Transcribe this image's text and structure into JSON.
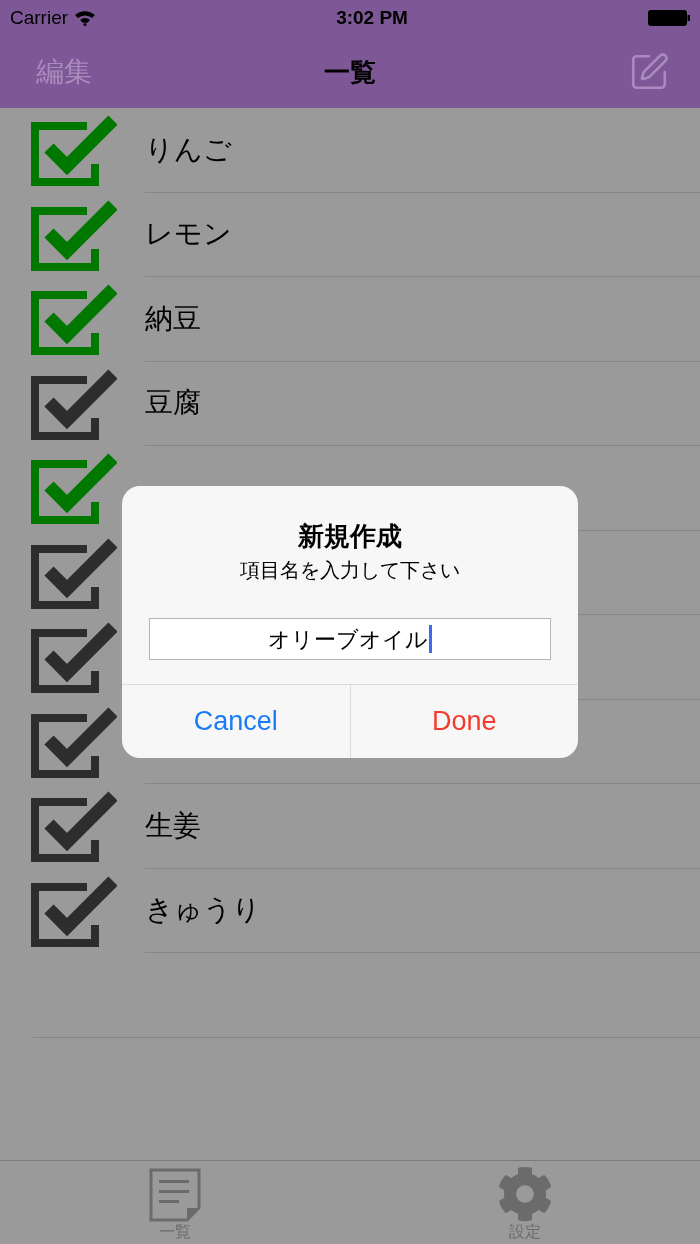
{
  "status_bar": {
    "carrier": "Carrier",
    "time": "3:02 PM"
  },
  "nav_bar": {
    "left_button": "編集",
    "title": "一覧"
  },
  "items": [
    {
      "name": "りんご",
      "checked": true
    },
    {
      "name": "レモン",
      "checked": true
    },
    {
      "name": "納豆",
      "checked": true
    },
    {
      "name": "豆腐",
      "checked": false
    },
    {
      "checked": true
    },
    {
      "checked": false
    },
    {
      "checked": false
    },
    {
      "checked": false
    },
    {
      "name": "生姜",
      "checked": false
    },
    {
      "name": "きゅうり",
      "checked": false
    }
  ],
  "dialog": {
    "title": "新規作成",
    "message": "項目名を入力して下さい",
    "value": "オリーブオイル",
    "buttons": [
      {
        "label": "Cancel",
        "kind": "cancel"
      },
      {
        "label": "Done",
        "kind": "destructive"
      }
    ]
  },
  "tab_bar": [
    {
      "label": "一覧",
      "kind": "list"
    },
    {
      "label": "設定",
      "kind": "settings"
    }
  ]
}
